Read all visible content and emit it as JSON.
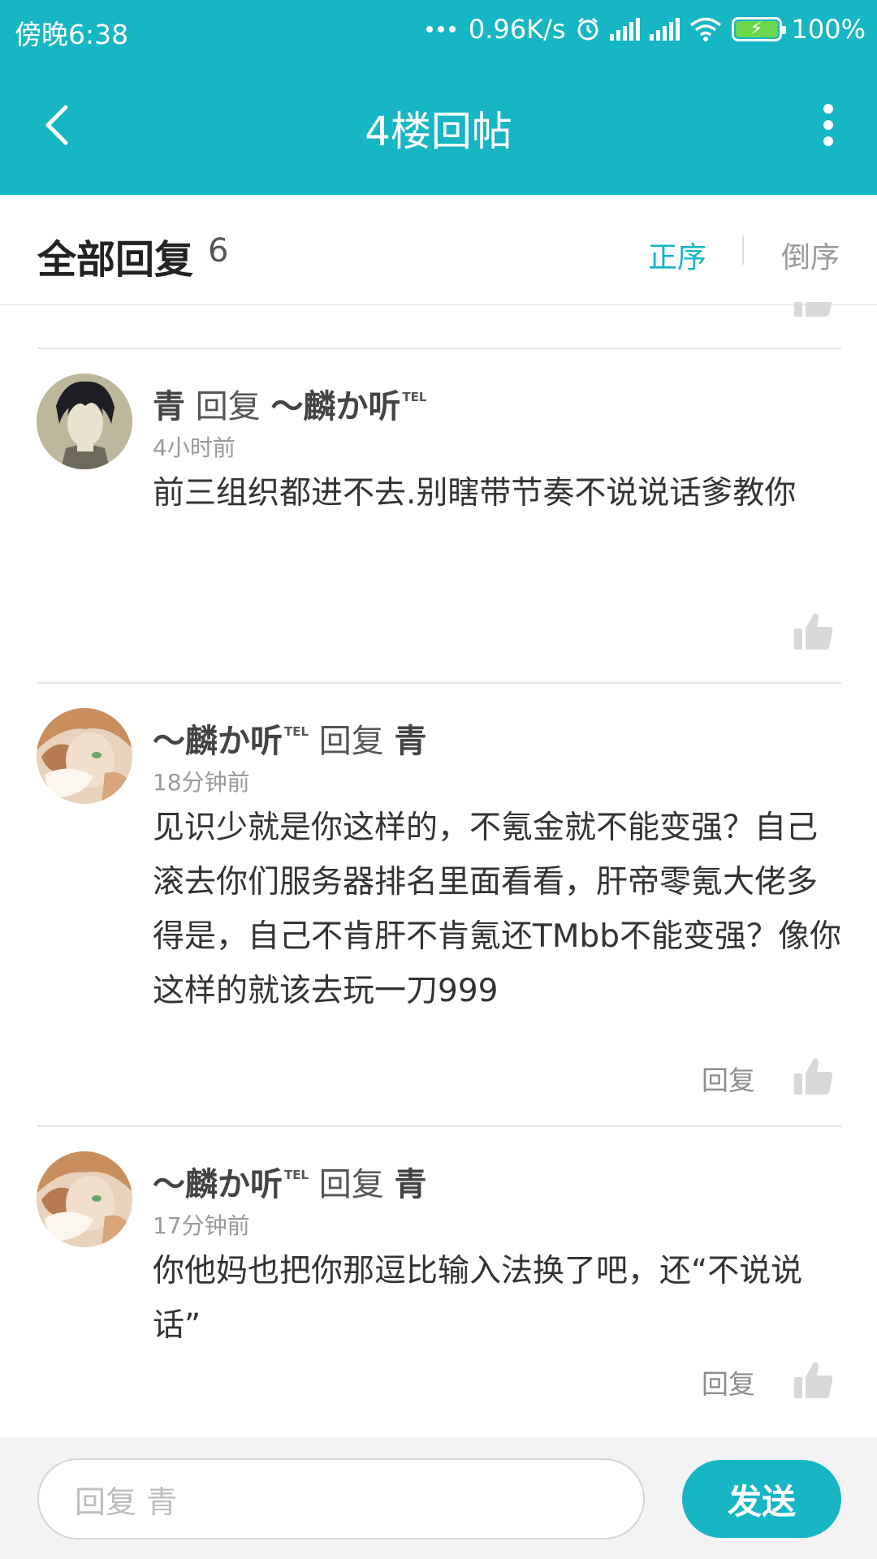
{
  "status_bar": {
    "time": "傍晚6:38",
    "network_speed": "0.96K/s",
    "battery": "100%",
    "icons": [
      "more-dots-icon",
      "alarm-icon",
      "signal-icon",
      "signal-icon",
      "wifi-icon",
      "battery-charging-icon"
    ]
  },
  "app_bar": {
    "title": "4楼回帖",
    "back_icon": "chevron-left-icon",
    "more_icon": "more-vertical-icon"
  },
  "reply_header": {
    "title": "全部回复",
    "count": "6",
    "sort_asc": "正序",
    "sort_desc": "倒序"
  },
  "replies": [
    {
      "author": "青",
      "verb": "回复",
      "target": "～麟か听",
      "target_badge": "TEL",
      "time": "4小时前",
      "content": "前三组织都进不去.别瞎带节奏不说说话爹教你",
      "reply_label": ""
    },
    {
      "author": "～麟か听",
      "author_badge": "TEL",
      "verb": "回复",
      "target": "青",
      "time": "18分钟前",
      "content": "见识少就是你这样的，不氪金就不能变强？自己滚去你们服务器排名里面看看，肝帝零氪大佬多得是，自己不肯肝不肯氪还TMbb不能变强？像你这样的就该去玩一刀999",
      "reply_label": "回复"
    },
    {
      "author": "～麟か听",
      "author_badge": "TEL",
      "verb": "回复",
      "target": "青",
      "time": "17分钟前",
      "content": "你他妈也把你那逗比输入法换了吧，还“不说说话”",
      "reply_label": "回复"
    }
  ],
  "composer": {
    "placeholder": "回复 青",
    "send_label": "发送"
  },
  "colors": {
    "accent": "#16b6c4",
    "text_primary": "#333333",
    "text_secondary": "#9a9a9a",
    "composer_bg": "#f3f3f3"
  }
}
